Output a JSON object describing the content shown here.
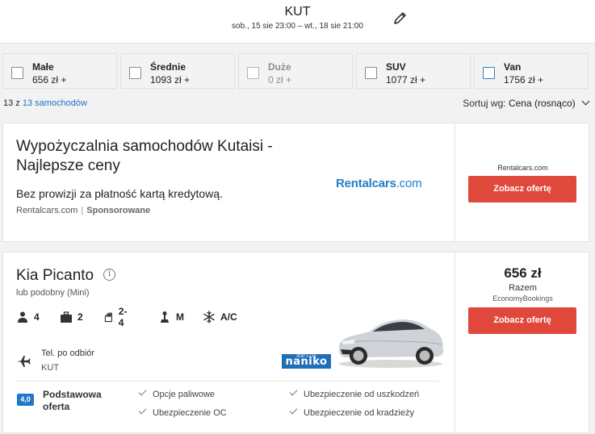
{
  "header": {
    "location": "KUT",
    "dates": "sob., 15 sie 23:00  –  wt., 18 sie 21:00"
  },
  "filters": [
    {
      "name": "Małe",
      "price": "656 zł +"
    },
    {
      "name": "Średnie",
      "price": "1093 zł +"
    },
    {
      "name": "Duże",
      "price": "0 zł +"
    },
    {
      "name": "SUV",
      "price": "1077 zł +"
    },
    {
      "name": "Van",
      "price": "1756 zł +"
    }
  ],
  "results": {
    "prefix": "13 z",
    "link": "13 samochodów"
  },
  "sort": {
    "label": "Sortuj wg:",
    "value": "Cena (rosnąco)"
  },
  "ad": {
    "title": "Wypożyczalnia samochodów Kutaisi - Najlepsze ceny",
    "description": "Bez prowizji za płatność kartą kredytową.",
    "domain": "Rentalcars.com",
    "separator": "|",
    "sponsored": "Sponsorowane",
    "logo_main": "Rentalcars",
    "logo_suffix": ".com",
    "source": "Rentalcars.com",
    "button": "Zobacz ofertę"
  },
  "car": {
    "name": "Kia Picanto",
    "info_glyph": "i",
    "similar": "lub podobny (Mini)",
    "specs": {
      "seats": "4",
      "bags": "2",
      "doors": "2-4",
      "transmission": "M",
      "ac": "A/C"
    },
    "pickup_label": "Tel. po odbiór",
    "pickup_location": "KUT",
    "supplier": "naniko",
    "supplier_small": "RENT A CAR",
    "score": "4,0",
    "offer_type": "Podstawowa oferta",
    "features": [
      "Opcje paliwowe",
      "Ubezpieczenie od uszkodzeń",
      "Ubezpieczenie OC",
      "Ubezpieczenie od kradzieży"
    ],
    "price": "656 zł",
    "total_label": "Razem",
    "broker": "EconomyBookings",
    "button": "Zobacz ofertę"
  },
  "colors": {
    "accent_button": "#e0483c",
    "link": "#1a73c8",
    "score_badge": "#2177c9"
  }
}
